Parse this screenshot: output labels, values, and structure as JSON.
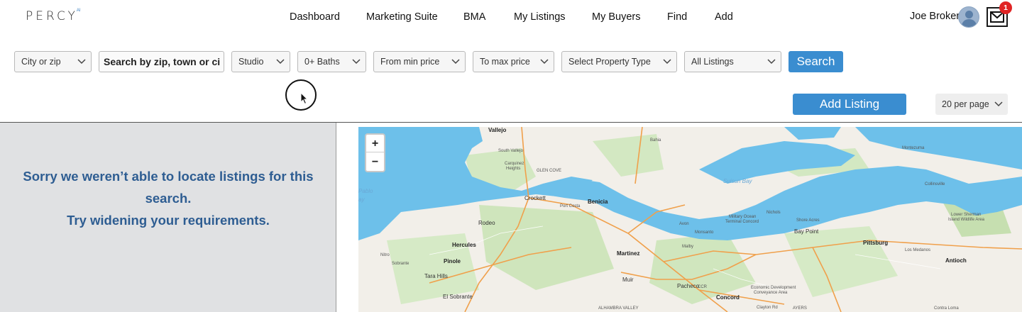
{
  "header": {
    "logo": {
      "text": "PERCY",
      "superscript": "AI"
    },
    "nav": [
      "Dashboard",
      "Marketing Suite",
      "BMA",
      "My Listings",
      "My Buyers",
      "Find",
      "Add"
    ],
    "user_name": "Joe Broker",
    "notification_count": "1"
  },
  "filters": {
    "location_type": "City or zip",
    "search_placeholder": "Search by zip, town or ci",
    "bedrooms": "Studio",
    "baths": "0+ Baths",
    "min_price": "From min price",
    "max_price": "To max price",
    "property_type": "Select Property Type",
    "listings": "All Listings",
    "search_button": "Search"
  },
  "actions": {
    "add_listing": "Add Listing",
    "per_page": "20 per page"
  },
  "results": {
    "message_line1": "Sorry we weren’t able to locate listings for this search.",
    "message_line2": "Try widening your requirements."
  },
  "map": {
    "zoom_in": "+",
    "zoom_out": "−",
    "labels": {
      "vallejo": "Vallejo",
      "south_vallejo": "South Vallejo",
      "carquinez": "Carquinez",
      "heights": "Heights",
      "glen_cove": "GLEN COVE",
      "benicia": "Benicia",
      "crockett": "Crockett",
      "port_costa": "Port Costa",
      "rodeo": "Rodeo",
      "hercules": "Hercules",
      "pinole": "Pinole",
      "sobrante": "Sobrante",
      "tara_hills": "Tara Hills",
      "el_sobrante": "El Sobrante",
      "nitro": "Nitro",
      "martinez": "Martinez",
      "muir": "Muir",
      "alhambra_valley": "ALHAMBRA VALLEY",
      "pacheco": "Pacheco",
      "concord": "Concord",
      "avon": "Avon",
      "monsanto": "Monsanto",
      "malby": "Malby",
      "military_ocean_1": "Military Ocean",
      "military_ocean_2": "Terminal Concord",
      "nichols": "Nichols",
      "shore_acres": "Shore Acres",
      "bay_point": "Bay Point",
      "pittsburg": "Pittsburg",
      "los_medanos": "Los Medanos",
      "antioch": "Antioch",
      "suisun_bay": "Suisun Bay",
      "montezuma": "Montezuma",
      "collinsville": "Collinsville",
      "bahia": "Bahia",
      "lower_sherman_1": "Lower Sherman",
      "lower_sherman_2": "Island Wildlife Area",
      "economic_1": "Economic Development",
      "economic_2": "Conveyance Area",
      "clayton_rd": "Clayton Rd",
      "ayers": "AYERS",
      "contra_loma": "Contra Loma",
      "pablo_1": "Pablo",
      "pablo_2": "ay",
      "ccr": "CCR"
    }
  },
  "colors": {
    "accent": "#3a8dd0",
    "message": "#2e5d92",
    "badge": "#e02424",
    "water": "#6dc0ea",
    "land": "#f2efe9",
    "park": "#c9e2b5"
  }
}
